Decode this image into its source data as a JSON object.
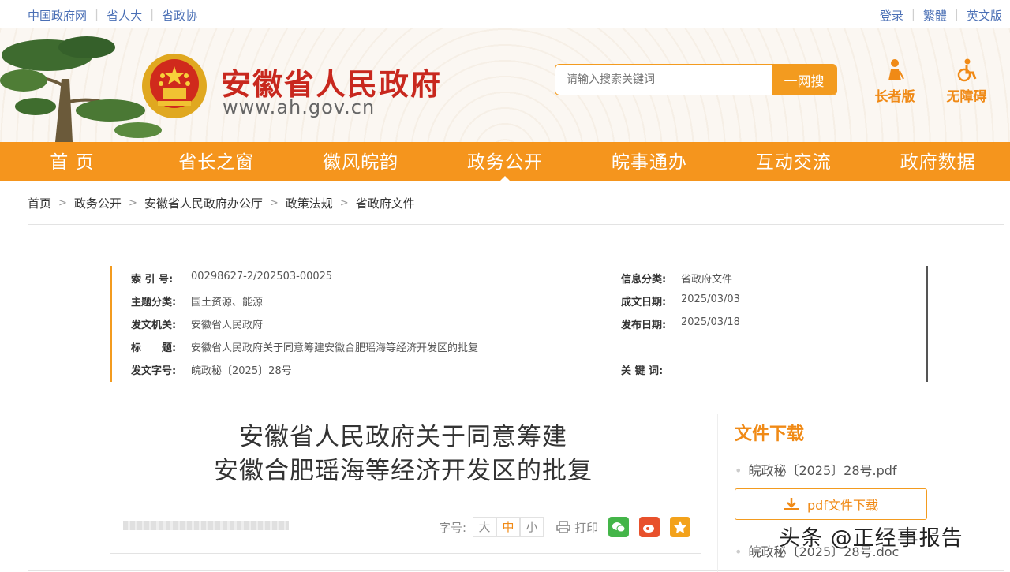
{
  "top_left_links": [
    "中国政府网",
    "省人大",
    "省政协"
  ],
  "top_right_links": [
    "登录",
    "繁體",
    "英文版"
  ],
  "header": {
    "title": "安徽省人民政府",
    "url": "www.ah.gov.cn",
    "search_placeholder": "请输入搜索关键词",
    "search_button": "一网搜",
    "elder_mode": "长者版",
    "accessibility": "无障碍"
  },
  "nav": [
    "首 页",
    "省长之窗",
    "徽风皖韵",
    "政务公开",
    "皖事通办",
    "互动交流",
    "政府数据"
  ],
  "nav_active_index": 3,
  "breadcrumb": [
    "首页",
    "政务公开",
    "安徽省人民政府办公厅",
    "政策法规",
    "省政府文件"
  ],
  "meta": {
    "index_label": "索 引 号:",
    "index_value": "00298627-2/202503-00025",
    "category_label": "信息分类:",
    "category_value": "省政府文件",
    "topic_label": "主题分类:",
    "topic_value": "国土资源、能源",
    "date_written_label": "成文日期:",
    "date_written_value": "2025/03/03",
    "issuer_label": "发文机关:",
    "issuer_value": "安徽省人民政府",
    "date_published_label": "发布日期:",
    "date_published_value": "2025/03/18",
    "title_label": "标　　题:",
    "title_value": "安徽省人民政府关于同意筹建安徽合肥瑶海等经济开发区的批复",
    "doc_no_label": "发文字号:",
    "doc_no_value": "皖政秘〔2025〕28号",
    "keywords_label": "关 键 词:",
    "keywords_value": ""
  },
  "document": {
    "title_line1": "安徽省人民政府关于同意筹建",
    "title_line2": "安徽合肥瑶海等经济开发区的批复"
  },
  "tools": {
    "font_size_label": "字号:",
    "font_large": "大",
    "font_medium": "中",
    "font_small": "小",
    "print": "打印"
  },
  "download": {
    "title": "文件下载",
    "file_pdf": "皖政秘〔2025〕28号.pdf",
    "pdf_button": "pdf文件下载",
    "file_doc": "皖政秘〔2025〕28号.doc"
  },
  "watermark": "头条 @正经事报告",
  "colors": {
    "accent": "#f5951d",
    "title_red": "#c8281e",
    "link_blue": "#4a6fb5"
  }
}
